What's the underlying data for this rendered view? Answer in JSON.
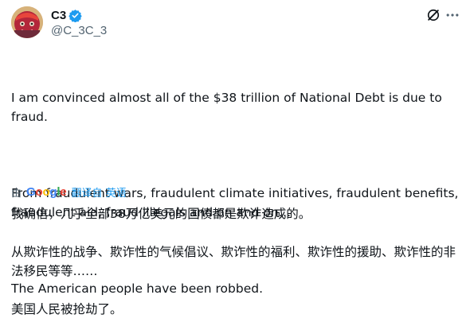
{
  "author": {
    "display_name": "C3",
    "handle": "@C_3C_3",
    "verified": true
  },
  "tweet": {
    "paragraphs": [
      "I am convinced almost all of the $38 trillion of National Debt is due to fraud.",
      "From fraudulent wars, fraudulent climate initiatives, fraudulent benefits, fraudulent aid, fraud illegals and on and on…",
      "The American people have been robbed."
    ]
  },
  "translation": {
    "by_label": "由",
    "provider": "Google",
    "link_label": "翻译自 英语",
    "paragraphs": [
      "我确信，几乎全部38万亿美元的国债都是欺诈造成的。",
      "从欺诈性的战争、欺诈性的气候倡议、欺诈性的福利、欺诈性的援助、欺诈性的非法移民等等……",
      "美国人民被抢劫了。"
    ]
  },
  "icons": {
    "verified": "verified-badge-icon",
    "grok": "grok-icon",
    "more": "more-options-icon"
  },
  "colors": {
    "accent": "#1d9bf0",
    "text": "#0f1419",
    "secondary": "#536471"
  }
}
